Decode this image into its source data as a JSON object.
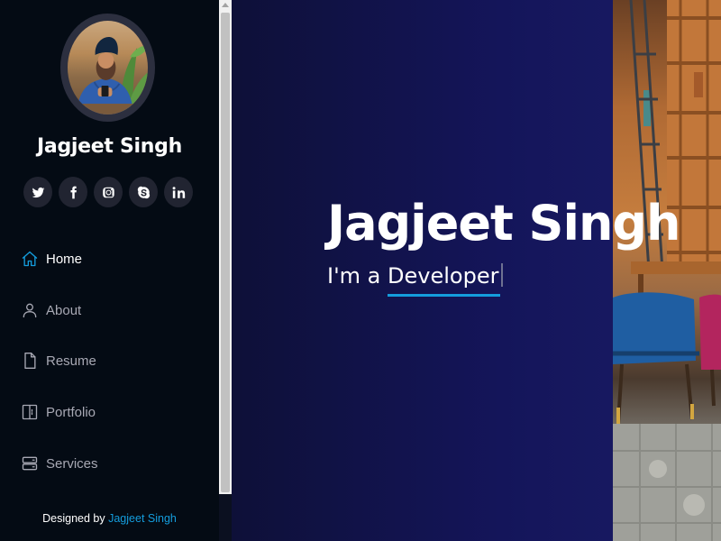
{
  "profile": {
    "name": "Jagjeet Singh"
  },
  "social": [
    {
      "icon": "twitter-icon"
    },
    {
      "icon": "facebook-icon"
    },
    {
      "icon": "instagram-icon"
    },
    {
      "icon": "skype-icon"
    },
    {
      "icon": "linkedin-icon"
    }
  ],
  "nav": {
    "items": [
      {
        "label": "Home",
        "icon": "home-icon",
        "active": true
      },
      {
        "label": "About",
        "icon": "person-icon",
        "active": false
      },
      {
        "label": "Resume",
        "icon": "file-icon",
        "active": false
      },
      {
        "label": "Portfolio",
        "icon": "book-icon",
        "active": false
      },
      {
        "label": "Services",
        "icon": "server-icon",
        "active": false
      }
    ]
  },
  "footer": {
    "prefix": "Designed by",
    "link_text": "Jagjeet Singh"
  },
  "hero": {
    "title": "Jagjeet Singh",
    "subtitle_prefix": "I'm a",
    "typed_text": "Developer"
  },
  "colors": {
    "accent": "#149ddd",
    "sidebar_bg": "#040b14",
    "hero_bg": "#14155a"
  }
}
